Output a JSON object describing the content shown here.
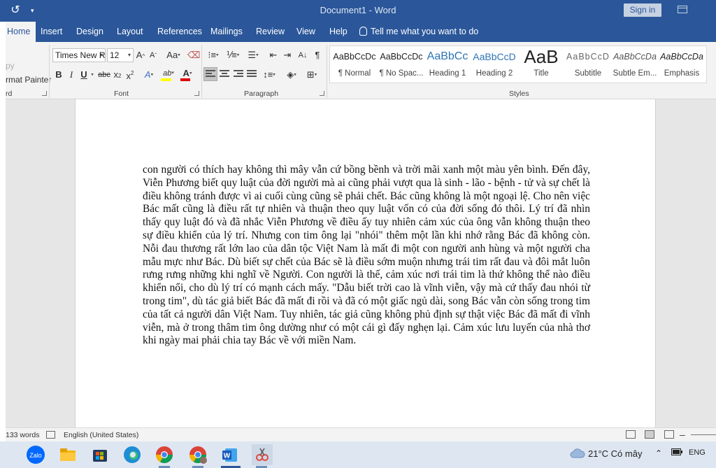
{
  "titlebar": {
    "doc_title": "Document1  -  Word",
    "signin": "Sign in",
    "refresh_glyph": "↺",
    "qat_glyph": "▾"
  },
  "tabs": {
    "home": "Home",
    "insert": "Insert",
    "design": "Design",
    "layout": "Layout",
    "references": "References",
    "mailings": "Mailings",
    "review": "Review",
    "view": "View",
    "help": "Help",
    "tellme": "Tell me what you want to do"
  },
  "ribbon": {
    "clipboard": {
      "copy_label": "py",
      "format_painter": "rmat Painter",
      "group_label": "rd"
    },
    "font": {
      "font_name": "Times New R",
      "font_size": "12",
      "grow": "A",
      "shrink": "A",
      "change_case": "Aa",
      "bold": "B",
      "italic": "I",
      "underline": "U",
      "strike": "abc",
      "subscript": "x",
      "superscript": "x",
      "text_effects": "A",
      "highlight": "ab",
      "font_color": "A",
      "group_label": "Font"
    },
    "paragraph": {
      "sort": "A↓",
      "pilcrow": "¶",
      "group_label": "Paragraph"
    },
    "styles": {
      "group_label": "Styles",
      "items": [
        {
          "sample": "AaBbCcDc",
          "name": "¶ Normal"
        },
        {
          "sample": "AaBbCcDc",
          "name": "¶ No Spac..."
        },
        {
          "sample": "AaBbCc",
          "name": "Heading 1"
        },
        {
          "sample": "AaBbCcD",
          "name": "Heading 2"
        },
        {
          "sample": "AaB",
          "name": "Title"
        },
        {
          "sample": "AaBbCcD",
          "name": "Subtitle"
        },
        {
          "sample": "AaBbCcDa",
          "name": "Subtle Em..."
        },
        {
          "sample": "AaBbCcDa",
          "name": "Emphasis"
        }
      ]
    }
  },
  "document": {
    "text": "con người có thích hay không thì mây vẫn cứ bồng bềnh và trời mãi xanh một màu yên bình. Đến đây, Viễn Phương biết quy luật của đời người mà ai cũng phải vượt qua là sinh - lão - bệnh - tử và sự chết là điều không tránh được vì ai cuối cùng cũng sẽ phải chết. Bác cũng không là một ngoại lệ. Cho nên việc Bác mất cũng là điều rất tự nhiên và thuận theo quy luật vốn có của đời sống đó thôi. Lý trí đã nhìn thấy quy luật đó và đã nhắc Viễn Phương về điều ấy tuy nhiên cảm xúc của ông vẫn không thuận theo sự điều khiển của lý trí. Nhưng con tim ông lại \"nhói\" thêm một lần khi nhớ rằng Bác đã không còn. Nỗi đau thương rất lớn lao của dân tộc Việt Nam là mất đi một con người anh hùng và một người cha mẫu mực như Bác. Dù biết sự chết của Bác sẽ là điều sớm muộn nhưng trái tim rất đau và đôi mắt luôn rưng rưng những khi nghĩ về Người. Con người là thế, cảm xúc nơi trái tim là thứ không thể nào điều khiển nổi, cho dù lý trí có mạnh cách mấy. \"Dẫu biết trời cao là vĩnh viễn, vậy mà cứ thấy đau nhói từ trong tim\", dù tác giả biết Bác đã mất đi rồi và đã có một giấc ngủ dài, song Bác vẫn còn sống trong tim của tất cả người dân Việt Nam. Tuy nhiên, tác giả cũng không phủ định sự thật việc Bác đã mất đi vĩnh viễn, mà ở trong thâm tim ông dường như có một cái gì đấy nghẹn lại. Cảm xúc lưu luyến của nhà thơ khi ngày mai phải chia tay Bác về với miền Nam."
  },
  "statusbar": {
    "words": "133 words",
    "language": "English (United States)"
  },
  "taskbar": {
    "weather": "21°C  Có mây",
    "lang": "ENG",
    "apps": [
      "zalo",
      "file-explorer",
      "store",
      "edge",
      "chrome",
      "chrome-profile",
      "word",
      "snipping-tool"
    ]
  },
  "colors": {
    "word_blue": "#2b579a",
    "ribbon_bg": "#f3f3f3",
    "heading_blue": "#2e74b5",
    "highlight_yellow": "#ffff00",
    "font_red": "#e00000"
  }
}
